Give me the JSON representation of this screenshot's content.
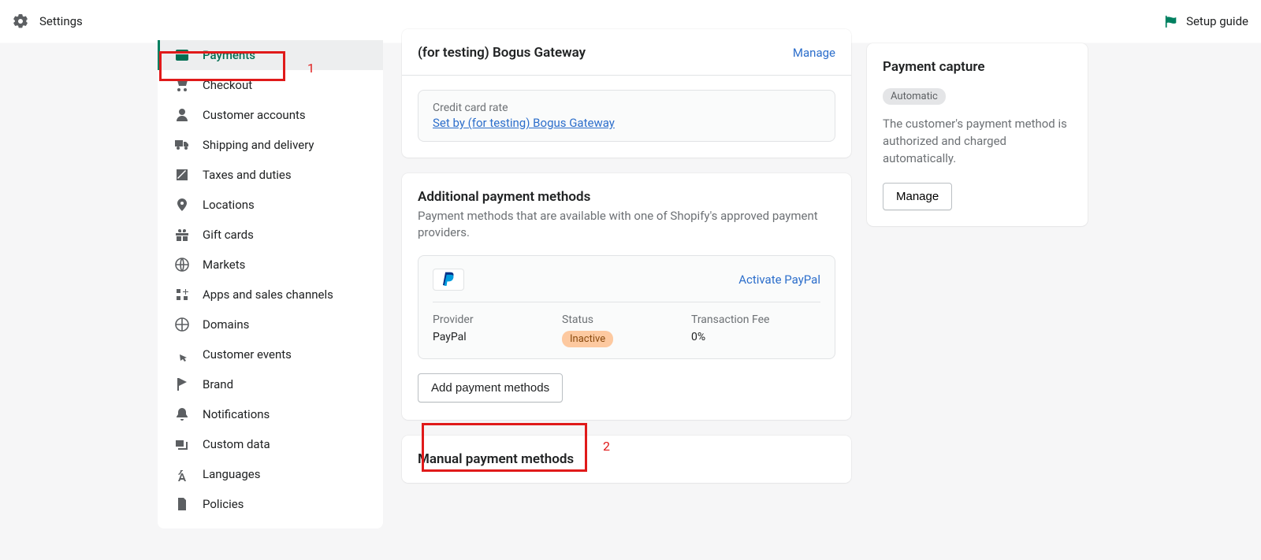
{
  "topbar": {
    "title": "Settings",
    "setup_guide": "Setup guide"
  },
  "sidebar": {
    "items": [
      {
        "label": "Payments",
        "active": true
      },
      {
        "label": "Checkout"
      },
      {
        "label": "Customer accounts"
      },
      {
        "label": "Shipping and delivery"
      },
      {
        "label": "Taxes and duties"
      },
      {
        "label": "Locations"
      },
      {
        "label": "Gift cards"
      },
      {
        "label": "Markets"
      },
      {
        "label": "Apps and sales channels"
      },
      {
        "label": "Domains"
      },
      {
        "label": "Customer events"
      },
      {
        "label": "Brand"
      },
      {
        "label": "Notifications"
      },
      {
        "label": "Custom data"
      },
      {
        "label": "Languages"
      },
      {
        "label": "Policies"
      }
    ]
  },
  "gateway": {
    "title": "(for testing) Bogus Gateway",
    "manage": "Manage",
    "rate_label": "Credit card rate",
    "rate_link": "Set by (for testing) Bogus Gateway"
  },
  "additional": {
    "title": "Additional payment methods",
    "subtitle": "Payment methods that are available with one of Shopify's approved payment providers.",
    "activate": "Activate PayPal",
    "provider_label": "Provider",
    "provider_value": "PayPal",
    "status_label": "Status",
    "status_value": "Inactive",
    "fee_label": "Transaction Fee",
    "fee_value": "0%",
    "add_button": "Add payment methods"
  },
  "manual": {
    "title": "Manual payment methods"
  },
  "capture": {
    "title": "Payment capture",
    "mode": "Automatic",
    "desc": "The customer's payment method is authorized and charged automatically.",
    "manage": "Manage"
  },
  "annotations": {
    "n1": "1",
    "n2": "2"
  }
}
